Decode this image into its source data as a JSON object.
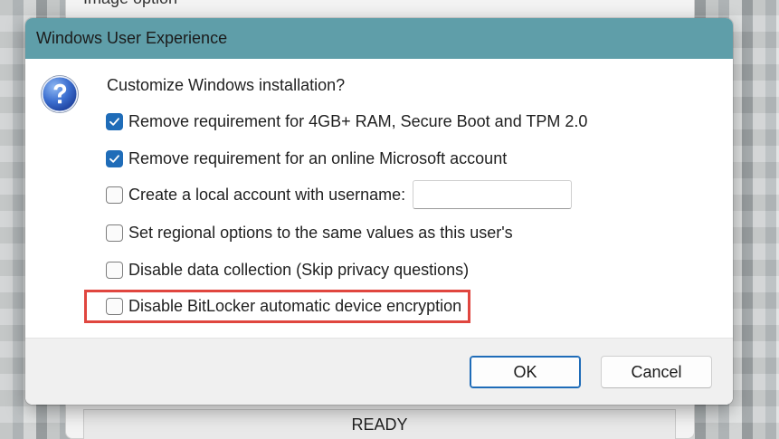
{
  "parent": {
    "option_label": "Image option",
    "status": "READY"
  },
  "dialog": {
    "title": "Windows User Experience",
    "question": "Customize Windows installation?",
    "options": [
      {
        "label": "Remove requirement for 4GB+ RAM, Secure Boot and TPM 2.0",
        "checked": true
      },
      {
        "label": "Remove requirement for an online Microsoft account",
        "checked": true
      },
      {
        "label": "Create a local account with username:",
        "checked": false,
        "input_value": ""
      },
      {
        "label": "Set regional options to the same values as this user's",
        "checked": false
      },
      {
        "label": "Disable data collection (Skip privacy questions)",
        "checked": false
      },
      {
        "label": "Disable BitLocker automatic device encryption",
        "checked": false
      }
    ],
    "ok_label": "OK",
    "cancel_label": "Cancel"
  },
  "colors": {
    "titlebar": "#5f9ea9",
    "accent": "#1f6cb8",
    "highlight": "#e0463f"
  },
  "icons": {
    "help": "question-mark-icon",
    "check": "checkmark-icon"
  }
}
